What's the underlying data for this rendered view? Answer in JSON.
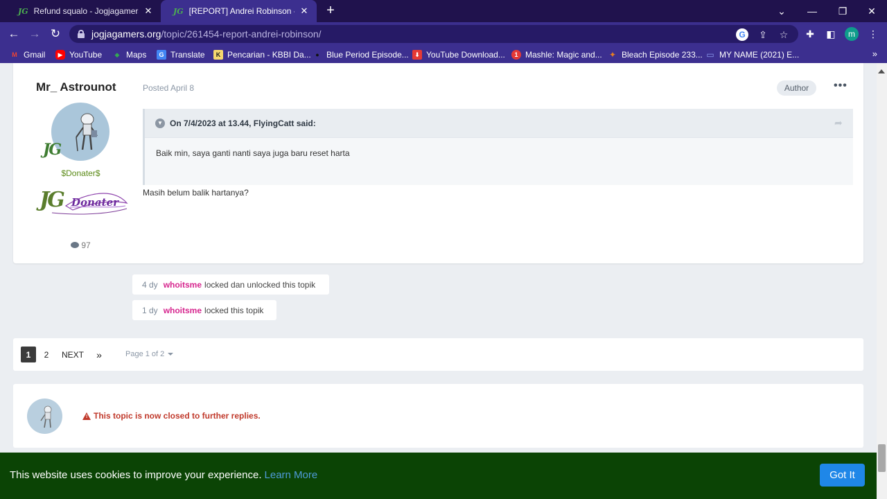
{
  "browser": {
    "tabs": [
      {
        "favicon": "JG",
        "title": "Refund squalo - Jogjagamers Co",
        "active": false
      },
      {
        "favicon": "JG",
        "title": "[REPORT] Andrei Robinson - Pag",
        "active": true
      }
    ],
    "new_tab_icon": "+",
    "window_controls": {
      "minimize": "chevron-down",
      "restore": "restore",
      "close": "close"
    },
    "address": {
      "domain": "jogjagamers.org",
      "path": "/topic/261454-report-andrei-robinson/"
    },
    "profile_initial": "m",
    "bookmarks": [
      {
        "label": "Gmail",
        "icon": "gmail-icon",
        "color": "#ea4335",
        "glyph": "M"
      },
      {
        "label": "YouTube",
        "icon": "youtube-icon",
        "color": "#ff0000",
        "glyph": "▶"
      },
      {
        "label": "Maps",
        "icon": "maps-icon",
        "color": "#34a853",
        "glyph": "◆"
      },
      {
        "label": "Translate",
        "icon": "translate-icon",
        "color": "#4285f4",
        "glyph": "G"
      },
      {
        "label": "Pencarian - KBBI Da...",
        "icon": "kbbi-icon",
        "color": "#1b1b1b",
        "glyph": "K"
      },
      {
        "label": "Blue Period Episode...",
        "icon": "blue-period-icon",
        "color": "#111111",
        "glyph": "●"
      },
      {
        "label": "YouTube Download...",
        "icon": "download-icon",
        "color": "#e53935",
        "glyph": "⬇"
      },
      {
        "label": "Mashle: Magic and...",
        "icon": "mashle-icon",
        "color": "#e53935",
        "glyph": "1"
      },
      {
        "label": "Bleach Episode 233...",
        "icon": "bleach-icon",
        "color": "#e67e22",
        "glyph": "✦"
      },
      {
        "label": "MY NAME (2021) E...",
        "icon": "tv-icon",
        "color": "#5c6bc0",
        "glyph": "▭"
      }
    ],
    "bookmarks_more": "»"
  },
  "post": {
    "author": "Mr_ Astrounot",
    "jg_badge": "JG",
    "group_title": "$Donater$",
    "donater_badge": {
      "jg": "JG",
      "word": "Donater"
    },
    "post_count": "97",
    "posted": "Posted April 8",
    "author_badge": "Author",
    "more_menu": "•••",
    "quote": {
      "citation": "On 7/4/2023 at 13.44, FlyingCatt said:",
      "text": "Baik min, saya ganti nanti saya juga baru reset harta"
    },
    "body": "Masih belum balik hartanya?"
  },
  "events": [
    {
      "time": "4 dy",
      "user": "whoitsme",
      "action": "locked dan unlocked this topik"
    },
    {
      "time": "1 dy",
      "user": "whoitsme",
      "action": "locked this topik"
    }
  ],
  "pagination": {
    "current": "1",
    "pages": [
      "2"
    ],
    "next": "NEXT",
    "last": "»",
    "page_of": "Page 1 of 2"
  },
  "closed_notice": "This topic is now closed to further replies.",
  "cookie": {
    "text": "This website uses cookies to improve your experience.",
    "link": "Learn More",
    "button": "Got It"
  }
}
